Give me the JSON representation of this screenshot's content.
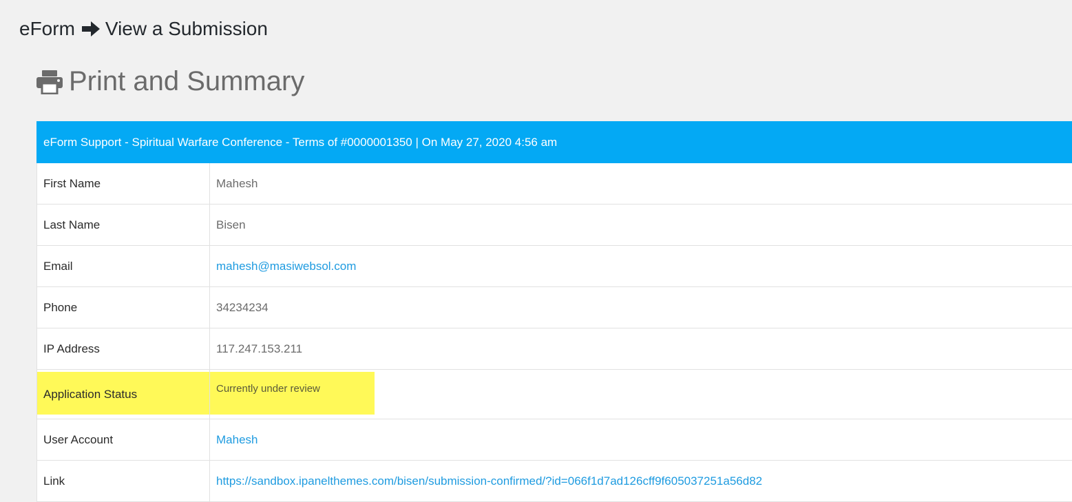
{
  "breadcrumb": {
    "root": "eForm",
    "current": "View a Submission"
  },
  "page": {
    "title": "Print and Summary"
  },
  "submission": {
    "header": "eForm Support - Spiritual Warfare Conference - Terms of #0000001350 | On May 27, 2020 4:56 am",
    "rows": [
      {
        "label": "First Name",
        "value": "Mahesh"
      },
      {
        "label": "Last Name",
        "value": "Bisen"
      },
      {
        "label": "Email",
        "value": "mahesh@masiwebsol.com"
      },
      {
        "label": "Phone",
        "value": "34234234"
      },
      {
        "label": "IP Address",
        "value": "117.247.153.211"
      },
      {
        "label": "Application Status",
        "value": "Currently under review"
      },
      {
        "label": "User Account",
        "value": "Mahesh"
      },
      {
        "label": "Link",
        "value": "https://sandbox.ipanelthemes.com/bisen/submission-confirmed/?id=066f1d7ad126cff9f605037251a56d82"
      }
    ]
  },
  "colors": {
    "header_bg": "#04a9f4",
    "link": "#1e9be0",
    "highlight": "#fff958"
  },
  "icons": {
    "breadcrumb_separator": "arrow-right-icon",
    "title_icon": "printer-icon"
  }
}
